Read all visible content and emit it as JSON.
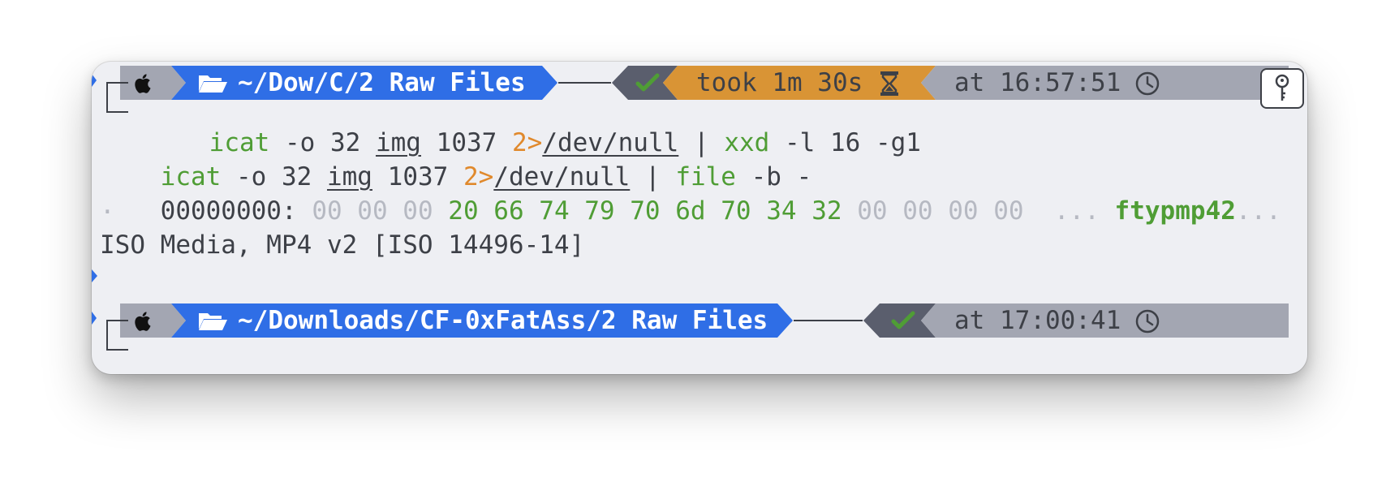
{
  "colors": {
    "window_bg": "#eeeff3",
    "segment_gray": "#a3a6b2",
    "segment_blue": "#2f6ee6",
    "segment_dark": "#5a5e6d",
    "segment_orange": "#d99435",
    "green": "#4f9d35",
    "orange": "#e0892c",
    "text": "#3d4047"
  },
  "prompt1": {
    "os_icon": "apple-icon",
    "folder_icon": "folder-open-icon",
    "path": "~/Dow/C/2 Raw Files",
    "status_icon": "check-icon",
    "duration": "took 1m 30s",
    "duration_icon": "hourglass-icon",
    "time": "at 16:57:51",
    "time_icon": "clock-icon"
  },
  "command1": {
    "cmd": "icat",
    "arg1": "-o 32",
    "arg2": "img",
    "arg3": "1037",
    "redirect": "2>",
    "target": "/dev/null",
    "pipe": "|",
    "cmd2": "xxd",
    "args2": "-l 16 -g1"
  },
  "echo": {
    "cmd": "icat",
    "arg1": "-o 32",
    "arg2": "img",
    "arg3": "1037",
    "redirect": "2>",
    "target": "/dev/null",
    "pipe": "|",
    "cmd2": "file",
    "args2": "-b -"
  },
  "hex": {
    "offset": "00000000:",
    "bytes_dim1": "00 00 00",
    "bytes_hi": "20 66 74 79 70 6d 70 34 32",
    "bytes_dim2": "00 00 00 00",
    "ascii_dim1": "...",
    "ascii_hi": "ftypmp42",
    "ascii_dim2": "...",
    "wrap": "."
  },
  "file_output": "ISO Media, MP4 v2 [ISO 14496-14]",
  "prompt2": {
    "os_icon": "apple-icon",
    "folder_icon": "folder-open-icon",
    "path": "~/Downloads/CF-0xFatAss/2 Raw Files",
    "status_icon": "check-icon",
    "time": "at 17:00:41",
    "time_icon": "clock-icon"
  },
  "key_button_icon": "key-icon"
}
